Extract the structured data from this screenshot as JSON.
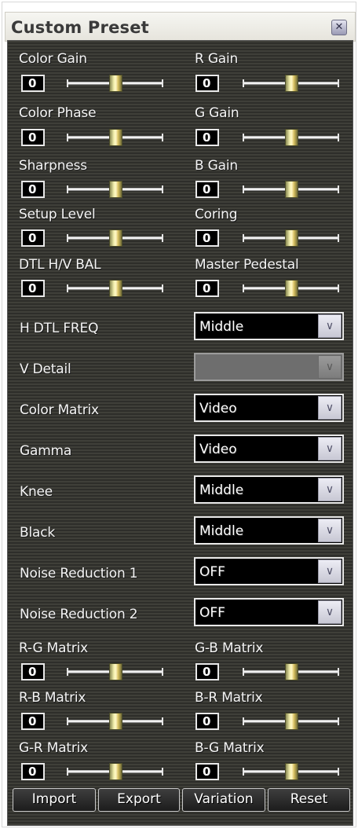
{
  "window": {
    "title": "Custom Preset",
    "close_glyph": "✕"
  },
  "sliders_top": [
    {
      "label": "Color Gain",
      "value": "0"
    },
    {
      "label": "R Gain",
      "value": "0"
    },
    {
      "label": "Color Phase",
      "value": "0"
    },
    {
      "label": "G Gain",
      "value": "0"
    },
    {
      "label": "Sharpness",
      "value": "0"
    },
    {
      "label": "B Gain",
      "value": "0"
    },
    {
      "label": "Setup Level",
      "value": "0"
    },
    {
      "label": "Coring",
      "value": "0"
    },
    {
      "label": "DTL H/V BAL",
      "value": "0"
    },
    {
      "label": "Master Pedestal",
      "value": "0"
    }
  ],
  "dropdowns": [
    {
      "label": "H DTL FREQ",
      "value": "Middle",
      "enabled": true
    },
    {
      "label": "V Detail",
      "value": "",
      "enabled": false
    },
    {
      "label": "Color Matrix",
      "value": "Video",
      "enabled": true
    },
    {
      "label": "Gamma",
      "value": "Video",
      "enabled": true
    },
    {
      "label": "Knee",
      "value": "Middle",
      "enabled": true
    },
    {
      "label": "Black",
      "value": "Middle",
      "enabled": true
    },
    {
      "label": "Noise Reduction 1",
      "value": "OFF",
      "enabled": true
    },
    {
      "label": "Noise Reduction 2",
      "value": "OFF",
      "enabled": true
    }
  ],
  "sliders_bottom": [
    {
      "label": "R-G Matrix",
      "value": "0"
    },
    {
      "label": "G-B Matrix",
      "value": "0"
    },
    {
      "label": "R-B Matrix",
      "value": "0"
    },
    {
      "label": "B-R Matrix",
      "value": "0"
    },
    {
      "label": "G-R Matrix",
      "value": "0"
    },
    {
      "label": "B-G Matrix",
      "value": "0"
    }
  ],
  "slider_position": 0.5,
  "dropdown_arrow_glyph": "∨",
  "buttons": {
    "import": "Import",
    "export": "Export",
    "variation": "Variation",
    "reset": "Reset"
  },
  "colors": {
    "panel_background": "#363631",
    "value_box": "#000000",
    "thumb": "#f4f0b0"
  }
}
